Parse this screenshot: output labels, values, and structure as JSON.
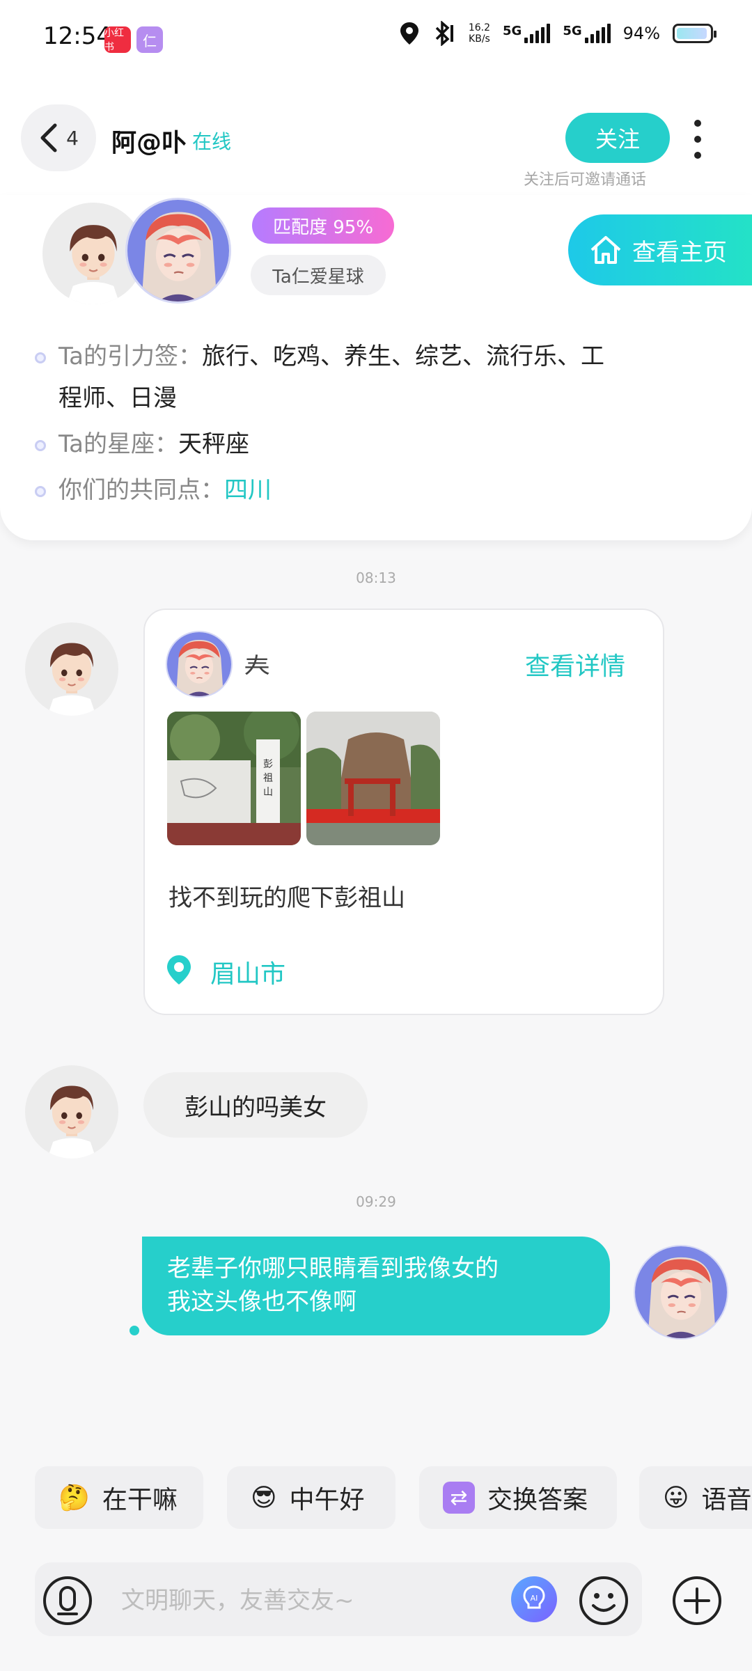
{
  "status_bar": {
    "time": "12:54",
    "app_badge_1": "小红书",
    "app_badge_2": "仁",
    "net_speed_value": "16.2",
    "net_speed_unit": "KB/s",
    "sig1_label": "5G",
    "sig2_label": "5G",
    "battery": "94%",
    "battery_level": 0.94
  },
  "header": {
    "back_count": "4",
    "name": "阿@卟",
    "status": "在线",
    "follow_label": "关注",
    "follow_hint": "关注后可邀请通话"
  },
  "profile": {
    "match": "匹配度 95%",
    "planet": "Ta仁爱星球",
    "homepage_label": "查看主页",
    "tags_label": "Ta的引力签：",
    "tags_value_line1": "旅行、吃鸡、养生、综艺、流行乐、工",
    "tags_value_line2": "程师、日漫",
    "zodiac_label": "Ta的星座：",
    "zodiac_value": "天秤座",
    "common_label": "你们的共同点：",
    "common_value": "四川"
  },
  "messages": {
    "time_1": "08:13",
    "post": {
      "author": "𡗗",
      "detail_label": "查看详情",
      "text": "找不到玩的爬下彭祖山",
      "location": "眉山市"
    },
    "incoming_text": "彭山的吗美女",
    "time_2": "09:29",
    "outgoing_line1": "老辈子你哪只眼睛看到我像女的",
    "outgoing_line2": "我这头像也不像啊"
  },
  "quick_replies": [
    {
      "icon": "🤔",
      "label": "在干嘛"
    },
    {
      "icon": "😎",
      "label": "中午好"
    },
    {
      "icon": "⇄",
      "label": "交换答案"
    },
    {
      "icon": "😛",
      "label": "语音"
    }
  ],
  "input": {
    "placeholder": "文明聊天，友善交友~"
  },
  "colors": {
    "accent": "#26cfcb",
    "match_gradient_start": "#b57cff",
    "match_gradient_end": "#f76bd3"
  }
}
